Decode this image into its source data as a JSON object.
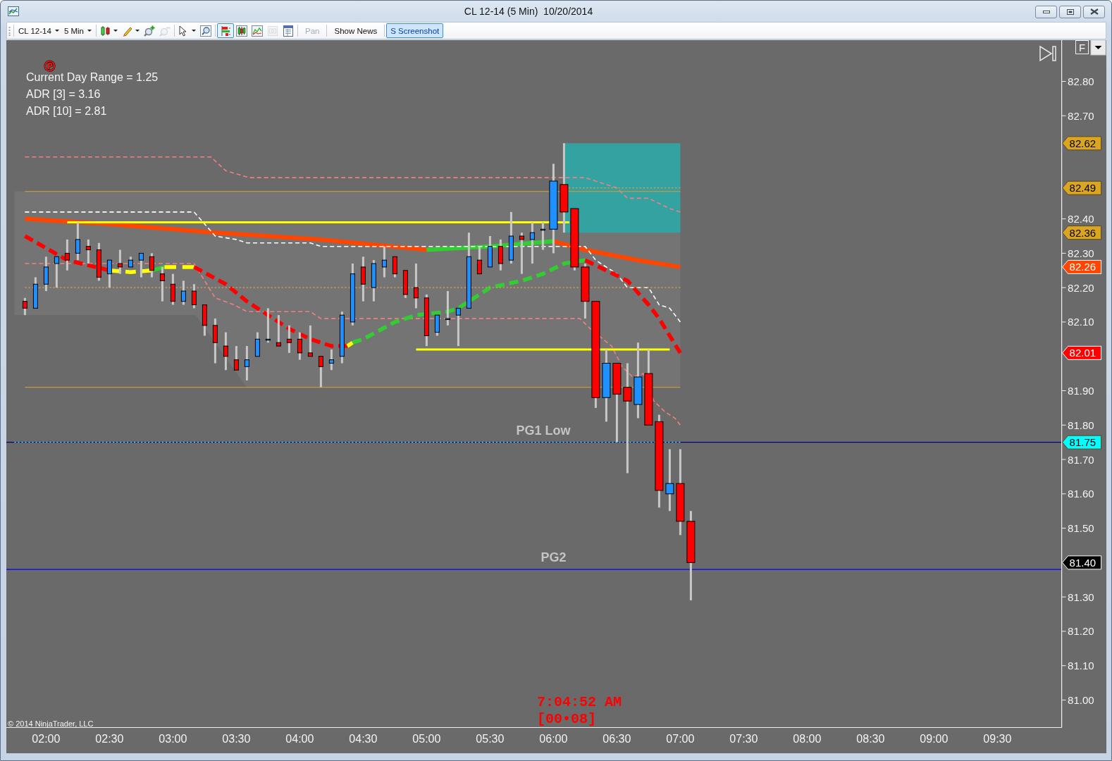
{
  "window": {
    "title": "CL 12-14 (5 Min)  10/20/2014"
  },
  "toolbar": {
    "selectors": [
      {
        "label": "CL 12-14"
      },
      {
        "label": "5 Min"
      }
    ],
    "tools": [
      {
        "menu": true,
        "disabled": false,
        "selected": false
      },
      {
        "menu": true,
        "disabled": false,
        "selected": false
      },
      {
        "menu": false,
        "disabled": false,
        "selected": false
      },
      {
        "menu": false,
        "disabled": true,
        "selected": false
      },
      {
        "menu": true,
        "disabled": false,
        "selected": false
      },
      {
        "menu": false,
        "disabled": false,
        "selected": false
      },
      {
        "menu": false,
        "disabled": false,
        "selected": true
      },
      {
        "menu": false,
        "disabled": false,
        "selected": false
      },
      {
        "menu": false,
        "disabled": false,
        "selected": false
      },
      {
        "menu": false,
        "disabled": true,
        "selected": false
      },
      {
        "menu": false,
        "disabled": false,
        "selected": false
      }
    ],
    "buttons": [
      {
        "label": "Pan",
        "disabled": true,
        "selected": false
      },
      {
        "label": "Show News",
        "disabled": false,
        "selected": false
      },
      {
        "label": "S Screenshot",
        "disabled": false,
        "selected": true
      }
    ]
  },
  "chart": {
    "pivot_mark": "Ⓟ",
    "info_lines": [
      "Current Day Range = 1.25",
      "ADR [3] = 3.16",
      "ADR [10] = 2.81"
    ],
    "corner_button": {
      "label": "F"
    },
    "copyright": "© 2014 NinjaTrader, LLC",
    "clock": {
      "time": "7:04:52 AM",
      "bar_countdown": "[00•08]"
    },
    "price_markers": [
      {
        "label": "82.62",
        "color": "#daa520"
      },
      {
        "label": "82.49",
        "color": "#daa520"
      },
      {
        "label": "82.36",
        "color": "#daa520"
      },
      {
        "label": "82.26",
        "color": "#ff4500"
      },
      {
        "label": "82.01",
        "color": "#ff0000"
      },
      {
        "label": "81.75",
        "color": "#00ffff"
      },
      {
        "label": "81.40",
        "color": "#000000"
      }
    ],
    "chart_data": [
      {
        "type": "candlestick",
        "x": [
          1.8333,
          1.9167,
          2,
          2.0833,
          2.1667,
          2.25,
          2.3333,
          2.4167,
          2.5,
          2.5833,
          2.6667,
          2.75,
          2.8333,
          2.9167,
          3,
          3.0833,
          3.1667,
          3.25,
          3.3333,
          3.4167,
          3.5,
          3.5833,
          3.6667,
          3.75,
          3.8333,
          3.9167,
          4,
          4.0833,
          4.1667,
          4.25,
          4.3333,
          4.4167,
          4.5,
          4.5833,
          4.6667,
          4.75,
          4.8333,
          4.9167,
          5,
          5.0833,
          5.1667,
          5.25,
          5.3333,
          5.4167,
          5.5,
          5.5833,
          5.6667,
          5.75,
          5.8333,
          5.9167,
          6,
          6.0833,
          6.1667,
          6.25,
          6.3333,
          6.4167,
          6.5,
          6.5833,
          6.6667,
          6.75,
          6.8333,
          6.9167,
          7,
          7.0833
        ],
        "ohlc": [
          [
            82.16,
            82.17,
            82.12,
            82.14
          ],
          [
            82.14,
            82.23,
            82.14,
            82.21
          ],
          [
            82.21,
            82.29,
            82.19,
            82.26
          ],
          [
            82.27,
            82.29,
            82.2,
            82.29
          ],
          [
            82.3,
            82.34,
            82.25,
            82.28
          ],
          [
            82.3,
            82.39,
            82.28,
            82.34
          ],
          [
            82.32,
            82.34,
            82.27,
            82.31
          ],
          [
            82.31,
            82.33,
            82.22,
            82.23
          ],
          [
            82.24,
            82.28,
            82.2,
            82.28
          ],
          [
            82.27,
            82.31,
            82.24,
            82.26
          ],
          [
            82.26,
            82.29,
            82.26,
            82.28
          ],
          [
            82.28,
            82.3,
            82.23,
            82.3
          ],
          [
            82.29,
            82.3,
            82.23,
            82.25
          ],
          [
            82.24,
            82.26,
            82.16,
            82.22
          ],
          [
            82.21,
            82.24,
            82.15,
            82.16
          ],
          [
            82.16,
            82.22,
            82.15,
            82.19
          ],
          [
            82.19,
            82.21,
            82.14,
            82.15
          ],
          [
            82.15,
            82.15,
            82.06,
            82.09
          ],
          [
            82.09,
            82.11,
            81.98,
            82.04
          ],
          [
            82.03,
            82.07,
            81.96,
            82.0
          ],
          [
            81.99,
            82.03,
            81.96,
            81.96
          ],
          [
            81.97,
            82.03,
            81.93,
            81.99
          ],
          [
            82.0,
            82.07,
            82.0,
            82.05
          ],
          [
            82.05,
            82.14,
            82.04,
            82.05
          ],
          [
            82.04,
            82.12,
            82.03,
            82.03
          ],
          [
            82.05,
            82.09,
            82.01,
            82.04
          ],
          [
            82.05,
            82.07,
            81.99,
            82.01
          ],
          [
            82.01,
            82.09,
            82.0,
            82.0
          ],
          [
            82.0,
            82.0,
            81.91,
            81.97
          ],
          [
            81.98,
            82.02,
            81.96,
            81.99
          ],
          [
            82.0,
            82.13,
            81.98,
            82.12
          ],
          [
            82.1,
            82.27,
            82.09,
            82.24
          ],
          [
            82.26,
            82.29,
            82.16,
            82.21
          ],
          [
            82.2,
            82.28,
            82.16,
            82.27
          ],
          [
            82.26,
            82.32,
            82.23,
            82.28
          ],
          [
            82.29,
            82.29,
            82.23,
            82.24
          ],
          [
            82.25,
            82.25,
            82.17,
            82.18
          ],
          [
            82.2,
            82.27,
            82.14,
            82.17
          ],
          [
            82.17,
            82.18,
            82.03,
            82.06
          ],
          [
            82.07,
            82.12,
            82.06,
            82.12
          ],
          [
            82.11,
            82.19,
            82.09,
            82.11
          ],
          [
            82.12,
            82.14,
            82.03,
            82.14
          ],
          [
            82.14,
            82.36,
            82.14,
            82.29
          ],
          [
            82.28,
            82.32,
            82.24,
            82.24
          ],
          [
            82.26,
            82.35,
            82.26,
            82.32
          ],
          [
            82.32,
            82.34,
            82.25,
            82.27
          ],
          [
            82.28,
            82.42,
            82.27,
            82.35
          ],
          [
            82.35,
            82.36,
            82.24,
            82.34
          ],
          [
            82.34,
            82.39,
            82.27,
            82.36
          ],
          [
            82.37,
            82.39,
            82.31,
            82.37
          ],
          [
            82.37,
            82.56,
            82.3,
            82.51
          ],
          [
            82.5,
            82.62,
            82.36,
            82.42
          ],
          [
            82.43,
            82.43,
            82.25,
            82.26
          ],
          [
            82.26,
            82.27,
            82.11,
            82.16
          ],
          [
            82.16,
            82.16,
            81.85,
            81.88
          ],
          [
            81.88,
            82.02,
            81.81,
            81.98
          ],
          [
            81.98,
            81.98,
            81.75,
            81.89
          ],
          [
            81.91,
            81.98,
            81.66,
            81.87
          ],
          [
            81.86,
            82.04,
            81.82,
            81.94
          ],
          [
            81.95,
            82.02,
            81.8,
            81.8
          ],
          [
            81.81,
            81.83,
            81.56,
            81.61
          ],
          [
            81.6,
            81.73,
            81.55,
            81.63
          ],
          [
            81.63,
            81.73,
            81.48,
            81.52
          ],
          [
            81.52,
            81.55,
            81.29,
            81.4
          ]
        ],
        "series": [
          {
            "type": "line",
            "color": "#ff4500",
            "line_style": "solid",
            "x": [
              1.8333,
              2.5,
              3.3333,
              4.1667,
              5.0
            ],
            "values": [
              82.4,
              82.385,
              82.36,
              82.34,
              82.31
            ]
          },
          {
            "type": "line",
            "color": "#32cd32",
            "line_style": "solid",
            "x": [
              5.0,
              5.5,
              6.0
            ],
            "values": [
              82.31,
              82.32,
              82.335
            ]
          },
          {
            "type": "line",
            "color": "#ff4500",
            "line_style": "solid",
            "x": [
              6.0,
              6.25,
              6.6667,
              7.0
            ],
            "values": [
              82.335,
              82.31,
              82.28,
              82.26
            ]
          },
          {
            "type": "line",
            "color": "#ffffff",
            "line_style": "dashed",
            "x": [
              1.8333,
              3.1667,
              3.3333,
              3.5,
              3.5833,
              4.0833,
              4.1667,
              6.25,
              6.3333,
              6.5,
              6.5833,
              6.75,
              6.8333,
              6.9167,
              7.0
            ],
            "values": [
              82.42,
              82.42,
              82.35,
              82.34,
              82.33,
              82.33,
              82.32,
              82.32,
              82.28,
              82.24,
              82.2,
              82.2,
              82.15,
              82.14,
              82.1
            ]
          },
          {
            "type": "line",
            "color": "#f08080",
            "line_style": "dashed",
            "x": [
              1.8333,
              3.3,
              3.4167,
              3.6,
              6.25,
              6.4167,
              6.5,
              6.5833,
              6.75,
              6.9167,
              7.0
            ],
            "values": [
              82.58,
              82.58,
              82.54,
              82.52,
              82.52,
              82.5,
              82.49,
              82.46,
              82.46,
              82.43,
              82.42
            ]
          },
          {
            "type": "line",
            "color": "#f08080",
            "line_style": "dashed",
            "x": [
              1.8333,
              3.1667,
              3.3333,
              3.4833,
              3.5833,
              4.0833,
              4.1667,
              6.2083,
              6.2917,
              6.4583,
              6.5417,
              6.625,
              6.7083,
              6.7917,
              6.875,
              6.9583,
              7.0
            ],
            "values": [
              82.27,
              82.27,
              82.17,
              82.15,
              82.13,
              82.13,
              82.11,
              82.11,
              82.08,
              82.03,
              81.97,
              81.94,
              81.95,
              81.87,
              81.84,
              81.82,
              81.8
            ]
          },
          {
            "type": "line",
            "color": "#ff0000",
            "line_style": "dashed",
            "x": [
              1.8333,
              2.1667,
              2.5
            ],
            "values": [
              82.35,
              82.28,
              82.25
            ]
          },
          {
            "type": "line",
            "color": "#ffff00",
            "line_style": "dashed",
            "x": [
              2.5,
              2.6667,
              2.8333
            ],
            "values": [
              82.25,
              82.245,
              82.25
            ]
          },
          {
            "type": "line",
            "color": "#32cd32",
            "line_style": "dashed",
            "x": [
              2.8333,
              2.9333
            ],
            "values": [
              82.25,
              82.26
            ]
          },
          {
            "type": "line",
            "color": "#ffff00",
            "line_style": "dashed",
            "x": [
              2.9333,
              3.1667
            ],
            "values": [
              82.26,
              82.26
            ]
          },
          {
            "type": "line",
            "color": "#ff0000",
            "line_style": "dashed",
            "x": [
              3.1667,
              3.4167,
              3.5833,
              3.75,
              3.9167,
              4.0833,
              4.25,
              4.375
            ],
            "values": [
              82.26,
              82.21,
              82.16,
              82.12,
              82.08,
              82.05,
              82.03,
              82.03
            ]
          },
          {
            "type": "line",
            "color": "#ffff00",
            "line_style": "dashed",
            "x": [
              4.375,
              4.4167
            ],
            "values": [
              82.03,
              82.04
            ]
          },
          {
            "type": "line",
            "color": "#32cd32",
            "line_style": "dashed",
            "x": [
              4.4167,
              4.5,
              4.75,
              4.9167,
              5.1667,
              5.25,
              5.5,
              5.75,
              5.9167,
              6.0833,
              6.25
            ],
            "values": [
              82.04,
              82.05,
              82.1,
              82.12,
              82.13,
              82.14,
              82.2,
              82.22,
              82.24,
              82.27,
              82.28
            ]
          },
          {
            "type": "line",
            "color": "#ff0000",
            "line_style": "dashed",
            "x": [
              6.25,
              6.4167,
              6.5833,
              6.75,
              6.8333,
              6.9167,
              7.0
            ],
            "values": [
              82.28,
              82.25,
              82.22,
              82.15,
              82.11,
              82.06,
              82.01
            ]
          },
          {
            "type": "line",
            "color": "#ffff00",
            "line_style": "solid",
            "x": [
              2.1667,
              6.125
            ],
            "values": [
              82.39,
              82.39
            ]
          },
          {
            "type": "line",
            "color": "#ffff00",
            "line_style": "solid",
            "x": [
              4.9167,
              6.9167
            ],
            "values": [
              82.02,
              82.02
            ]
          },
          {
            "type": "line",
            "color": "#c8963c",
            "line_style": "solid",
            "x": [
              1.8333,
              7.0
            ],
            "values": [
              82.48,
              82.48
            ]
          },
          {
            "type": "line",
            "color": "#e0a040",
            "line_style": "dotted",
            "x": [
              1.8333,
              7.0
            ],
            "values": [
              82.2,
              82.2
            ]
          },
          {
            "type": "line",
            "color": "#c8963c",
            "line_style": "solid",
            "x": [
              1.8333,
              7.0
            ],
            "values": [
              81.91,
              81.91
            ]
          },
          {
            "type": "line",
            "color": "#e0a040",
            "line_style": "dotted",
            "x": [
              6.12,
              7.0
            ],
            "values": [
              82.49,
              82.49
            ]
          },
          {
            "type": "line",
            "color": "#40e0e0",
            "line_style": "dotted",
            "x": [
              1.75,
              7.0
            ],
            "values": [
              81.75,
              81.75
            ]
          }
        ],
        "xlim": [
          1.6867,
          10.0067
        ],
        "ylim": [
          80.92,
          82.92
        ],
        "xticks": [
          {
            "value": 2,
            "label": "02:00"
          },
          {
            "value": 2.5,
            "label": "02:30"
          },
          {
            "value": 3,
            "label": "03:00"
          },
          {
            "value": 3.5,
            "label": "03:30"
          },
          {
            "value": 4,
            "label": "04:00"
          },
          {
            "value": 4.5,
            "label": "04:30"
          },
          {
            "value": 5,
            "label": "05:00"
          },
          {
            "value": 5.5,
            "label": "05:30"
          },
          {
            "value": 6,
            "label": "06:00"
          },
          {
            "value": 6.5,
            "label": "06:30"
          },
          {
            "value": 7,
            "label": "07:00"
          },
          {
            "value": 7.5,
            "label": "07:30"
          },
          {
            "value": 8,
            "label": "08:00"
          },
          {
            "value": 8.5,
            "label": "08:30"
          },
          {
            "value": 9,
            "label": "09:00"
          },
          {
            "value": 9.5,
            "label": "09:30"
          }
        ],
        "yticks": [
          {
            "value": 82.8,
            "label": "82.80"
          },
          {
            "value": 82.7,
            "label": "82.70"
          },
          {
            "value": 82.4,
            "label": "82.40"
          },
          {
            "value": 82.3,
            "label": "82.30"
          },
          {
            "value": 82.2,
            "label": "82.20"
          },
          {
            "value": 82.1,
            "label": "82.10"
          },
          {
            "value": 81.9,
            "label": "81.90"
          },
          {
            "value": 81.8,
            "label": "81.80"
          },
          {
            "value": 81.7,
            "label": "81.70"
          },
          {
            "value": 81.6,
            "label": "81.60"
          },
          {
            "value": 81.5,
            "label": "81.50"
          },
          {
            "value": 81.3,
            "label": "81.30"
          },
          {
            "value": 81.2,
            "label": "81.20"
          },
          {
            "value": 81.1,
            "label": "81.10"
          },
          {
            "value": 81.0,
            "label": "81.00"
          }
        ],
        "bands": [
          {
            "axis": "y",
            "from": 82.36,
            "to": 82.62,
            "color": "#35a2a2"
          }
        ],
        "ref_lines": [
          {
            "axis": "y",
            "value": 81.75,
            "label": "PG1 Low",
            "color": "#000080"
          },
          {
            "axis": "y",
            "value": 81.38,
            "label": "PG2",
            "color": "#0000ff"
          }
        ]
      }
    ]
  }
}
